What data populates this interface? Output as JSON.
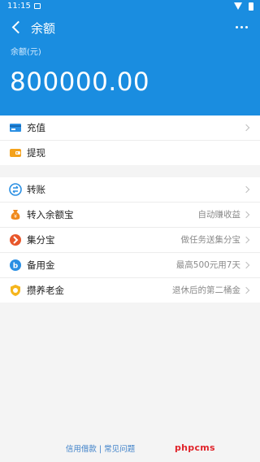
{
  "status_bar": {
    "time": "11:15"
  },
  "header": {
    "title": "余额",
    "balance_label": "余额(元)",
    "balance_value": "800000.00"
  },
  "group1": [
    {
      "label": "充值",
      "hint": "",
      "icon": "card-icon"
    },
    {
      "label": "提现",
      "hint": "",
      "icon": "wallet-icon"
    }
  ],
  "group2": [
    {
      "label": "转账",
      "hint": "",
      "icon": "transfer-icon"
    },
    {
      "label": "转入余额宝",
      "hint": "自动赚收益",
      "icon": "money-bag-icon"
    },
    {
      "label": "集分宝",
      "hint": "做任务送集分宝",
      "icon": "points-icon"
    },
    {
      "label": "备用金",
      "hint": "最高500元用7天",
      "icon": "reserve-fund-icon"
    },
    {
      "label": "攒养老金",
      "hint": "退休后的第二桶金",
      "icon": "pension-icon"
    }
  ],
  "footer": {
    "link1": "信用借款",
    "separator": "|",
    "link2": "常见问题"
  },
  "watermark": "phpcms",
  "colors": {
    "header_bg": "#1a8de0",
    "accent": "#1a8de0",
    "link": "#3d80c9",
    "watermark": "#e0242b"
  }
}
